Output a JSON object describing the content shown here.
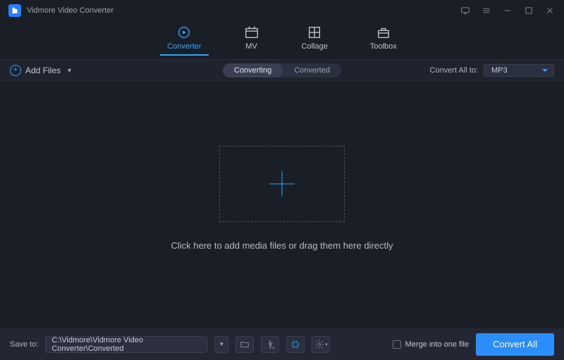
{
  "header": {
    "title": "Vidmore Video Converter"
  },
  "nav": {
    "tabs": [
      {
        "label": "Converter"
      },
      {
        "label": "MV"
      },
      {
        "label": "Collage"
      },
      {
        "label": "Toolbox"
      }
    ]
  },
  "subbar": {
    "add_label": "Add Files",
    "toggle_converting": "Converting",
    "toggle_converted": "Converted",
    "convert_all_to_label": "Convert All to:",
    "selected_format": "MP3"
  },
  "main": {
    "hint": "Click here to add media files or drag them here directly"
  },
  "bottombar": {
    "save_to_label": "Save to:",
    "save_path": "C:\\Vidmore\\Vidmore Video Converter\\Converted",
    "merge_label": "Merge into one file",
    "convert_all_button": "Convert All"
  }
}
